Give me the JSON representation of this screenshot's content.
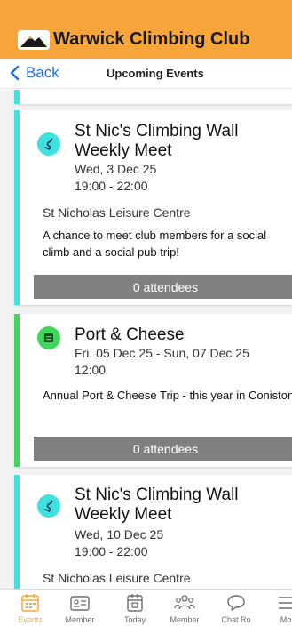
{
  "header": {
    "title": "Warwick Climbing Club",
    "accent": "#f5a53a"
  },
  "nav": {
    "back_label": "Back",
    "title": "Upcoming Events",
    "link_color": "#1f6fe0"
  },
  "events": [
    {
      "name_line1": "St Nic's Climbing Wall",
      "name_line2": "Weekly Meet",
      "date": "Wed, 3 Dec 25",
      "time": "19:00 - 22:00",
      "location": "St Nicholas Leisure Centre",
      "description": "A chance to meet club members for a social climb and a social pub trip!",
      "attendees": "0 attendees",
      "icon": "climbing-icon",
      "color": "#3ee0e0"
    },
    {
      "name_line1": "Port & Cheese",
      "date": "Fri, 05 Dec 25 - Sun, 07 Dec 25",
      "time": "12:00",
      "description": "Annual Port & Cheese Trip - this year in Coniston",
      "attendees": "0 attendees",
      "icon": "trip-icon",
      "color": "#3fd65a"
    },
    {
      "name_line1": "St Nic's Climbing Wall",
      "name_line2": "Weekly Meet",
      "date": "Wed, 10 Dec 25",
      "time": "19:00 - 22:00",
      "location": "St Nicholas Leisure Centre",
      "icon": "climbing-icon",
      "color": "#3ee0e0"
    }
  ],
  "tabs": [
    {
      "label": "Events",
      "icon": "calendar-icon",
      "active": true
    },
    {
      "label": "Member",
      "icon": "member-card-icon"
    },
    {
      "label": "Today",
      "icon": "today-icon"
    },
    {
      "label": "Member",
      "icon": "members-group-icon"
    },
    {
      "label": "Chat Ro",
      "icon": "chat-icon"
    },
    {
      "label": "Mo",
      "icon": "more-icon"
    }
  ]
}
